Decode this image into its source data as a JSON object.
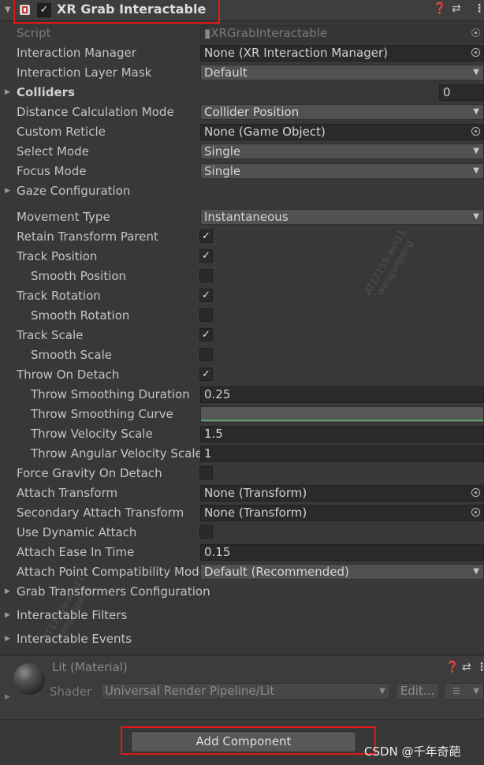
{
  "header": {
    "title": "XR Grab Interactable",
    "enabled": true,
    "help_icon": "help-icon",
    "preset_icon": "presets-icon",
    "menu_icon": "kebab-menu-icon"
  },
  "fields": {
    "script": {
      "label": "Script",
      "value": "XRGrabInteractable"
    },
    "interaction_manager": {
      "label": "Interaction Manager",
      "value": "None (XR Interaction Manager)"
    },
    "interaction_layer_mask": {
      "label": "Interaction Layer Mask",
      "value": "Default"
    },
    "colliders": {
      "label": "Colliders",
      "value": "0"
    },
    "distance_calc_mode": {
      "label": "Distance Calculation Mode",
      "value": "Collider Position"
    },
    "custom_reticle": {
      "label": "Custom Reticle",
      "value": "None (Game Object)"
    },
    "select_mode": {
      "label": "Select Mode",
      "value": "Single"
    },
    "focus_mode": {
      "label": "Focus Mode",
      "value": "Single"
    },
    "gaze_configuration": {
      "label": "Gaze Configuration"
    },
    "movement_type": {
      "label": "Movement Type",
      "value": "Instantaneous"
    },
    "retain_transform_parent": {
      "label": "Retain Transform Parent",
      "checked": true
    },
    "track_position": {
      "label": "Track Position",
      "checked": true
    },
    "smooth_position": {
      "label": "Smooth Position",
      "checked": false
    },
    "track_rotation": {
      "label": "Track Rotation",
      "checked": true
    },
    "smooth_rotation": {
      "label": "Smooth Rotation",
      "checked": false
    },
    "track_scale": {
      "label": "Track Scale",
      "checked": true
    },
    "smooth_scale": {
      "label": "Smooth Scale",
      "checked": false
    },
    "throw_on_detach": {
      "label": "Throw On Detach",
      "checked": true
    },
    "throw_smoothing_duration": {
      "label": "Throw Smoothing Duration",
      "value": "0.25"
    },
    "throw_smoothing_curve": {
      "label": "Throw Smoothing Curve"
    },
    "throw_velocity_scale": {
      "label": "Throw Velocity Scale",
      "value": "1.5"
    },
    "throw_angular_velocity_scale": {
      "label": "Throw Angular Velocity Scale",
      "value": "1"
    },
    "force_gravity_on_detach": {
      "label": "Force Gravity On Detach",
      "checked": false
    },
    "attach_transform": {
      "label": "Attach Transform",
      "value": "None (Transform)"
    },
    "secondary_attach_transform": {
      "label": "Secondary Attach Transform",
      "value": "None (Transform)"
    },
    "use_dynamic_attach": {
      "label": "Use Dynamic Attach",
      "checked": false
    },
    "attach_ease_in_time": {
      "label": "Attach Ease In Time",
      "value": "0.15"
    },
    "attach_point_compat_mode": {
      "label": "Attach Point Compatibility Mode",
      "value": "Default (Recommended)"
    },
    "grab_transformers_config": {
      "label": "Grab Transformers Configuration"
    },
    "interactable_filters": {
      "label": "Interactable Filters"
    },
    "interactable_events": {
      "label": "Interactable Events"
    }
  },
  "material": {
    "title": "Lit (Material)",
    "shader_label": "Shader",
    "shader_value": "Universal Render Pipeline/Lit",
    "edit_label": "Edit..."
  },
  "footer": {
    "add_component": "Add Component",
    "watermark": "CSDN @千年奇葩"
  },
  "overlay_watermark": {
    "line1": "AT17159-win11",
    "line2": "wangunpeng"
  },
  "colors": {
    "background": "#383838",
    "field": "#2a2a2a",
    "dropdown": "#515151",
    "highlight_box": "#e01818",
    "curve_line": "#54a36b"
  }
}
